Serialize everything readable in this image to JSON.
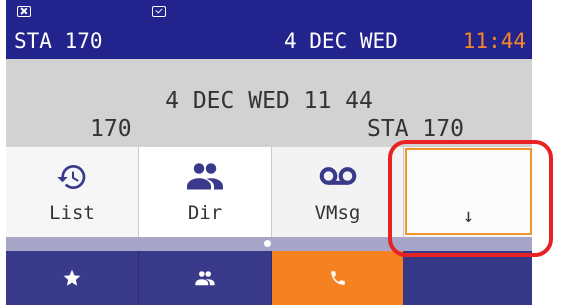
{
  "status_bar": {
    "station": "STA 170",
    "date": "4 DEC WED",
    "time": "11:44",
    "icons": [
      "missed-call-icon",
      "message-check-icon"
    ],
    "time_color": "#f5862a"
  },
  "info": {
    "datetime": "4 DEC WED 11 44",
    "number": "170",
    "station": "STA 170"
  },
  "softkeys": [
    {
      "label": "List",
      "icon": "history-icon"
    },
    {
      "label": "Dir",
      "icon": "people-icon"
    },
    {
      "label": "VMsg",
      "icon": "voicemail-icon"
    },
    {
      "label": "↓",
      "icon": ""
    }
  ],
  "tabs": [
    {
      "icon": "star-icon"
    },
    {
      "icon": "contacts-icon"
    },
    {
      "icon": "phone-icon",
      "active": true
    },
    {
      "icon": ""
    }
  ],
  "colors": {
    "status_bg": "#22238c",
    "accent": "#f58120",
    "highlight": "#e82222"
  }
}
